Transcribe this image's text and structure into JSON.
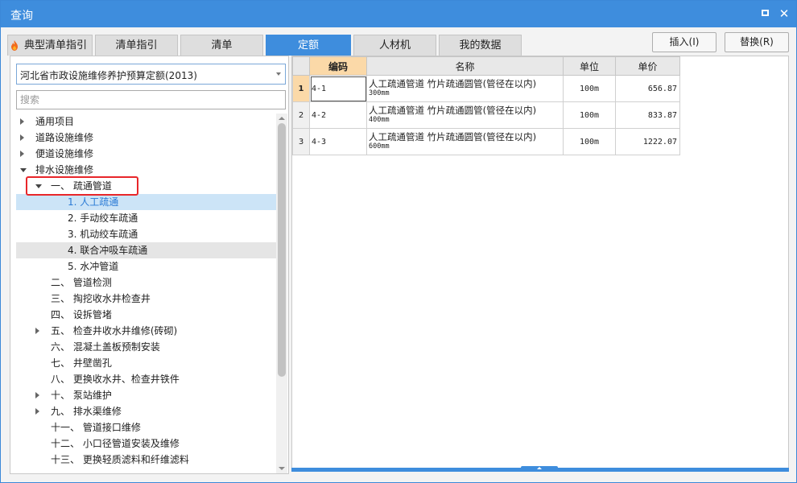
{
  "window": {
    "title": "查询"
  },
  "tabs": [
    {
      "label": "典型清单指引",
      "active": false
    },
    {
      "label": "清单指引",
      "active": false
    },
    {
      "label": "清单",
      "active": false
    },
    {
      "label": "定额",
      "active": true
    },
    {
      "label": "人材机",
      "active": false
    },
    {
      "label": "我的数据",
      "active": false
    }
  ],
  "actions": {
    "insert": "插入(I)",
    "replace": "替换(R)"
  },
  "left": {
    "selected_library": "河北省市政设施维修养护预算定额(2013)",
    "search_placeholder": "搜索",
    "tree": [
      {
        "label": "通用项目",
        "expander": "collapsed"
      },
      {
        "label": "道路设施维修",
        "expander": "collapsed"
      },
      {
        "label": "便道设施维修",
        "expander": "collapsed"
      },
      {
        "label": "排水设施维修",
        "expander": "expanded"
      },
      {
        "label": "一、 疏通管道",
        "expander": "expanded"
      },
      {
        "label": "1. 人工疏通",
        "expander": "none",
        "state": "selected"
      },
      {
        "label": "2. 手动绞车疏通",
        "expander": "none"
      },
      {
        "label": "3. 机动绞车疏通",
        "expander": "none"
      },
      {
        "label": "4. 联合冲吸车疏通",
        "expander": "none",
        "state": "hover"
      },
      {
        "label": "5. 水冲管道",
        "expander": "none"
      },
      {
        "label": "二、 管道检测",
        "expander": "none"
      },
      {
        "label": "三、 掏挖收水井检查井",
        "expander": "none"
      },
      {
        "label": "四、 设拆管堵",
        "expander": "none"
      },
      {
        "label": "五、 检查井收水井维修(砖砌)",
        "expander": "collapsed"
      },
      {
        "label": "六、 混凝土盖板预制安装",
        "expander": "none"
      },
      {
        "label": "七、 井壁凿孔",
        "expander": "none"
      },
      {
        "label": "八、 更换收水井、检查井铁件",
        "expander": "none"
      },
      {
        "label": "十、 泵站维护",
        "expander": "collapsed"
      },
      {
        "label": "九、 排水渠维修",
        "expander": "collapsed"
      },
      {
        "label": "十一、 管道接口维修",
        "expander": "none"
      },
      {
        "label": "十二、 小口径管道安装及维修",
        "expander": "none"
      },
      {
        "label": "十三、 更换轻质滤料和纤维滤料",
        "expander": "none"
      }
    ]
  },
  "grid": {
    "columns": [
      "编码",
      "名称",
      "单位",
      "单价"
    ],
    "rows": [
      {
        "num": "1",
        "code": "4-1",
        "name": "人工疏通管道 竹片疏通圆管(管径在以内)",
        "spec": "300mm",
        "unit": "100m",
        "price": "656.87"
      },
      {
        "num": "2",
        "code": "4-2",
        "name": "人工疏通管道 竹片疏通圆管(管径在以内)",
        "spec": "400mm",
        "unit": "100m",
        "price": "833.87"
      },
      {
        "num": "3",
        "code": "4-3",
        "name": "人工疏通管道 竹片疏通圆管(管径在以内)",
        "spec": "600mm",
        "unit": "100m",
        "price": "1222.07"
      }
    ]
  },
  "colors": {
    "accent": "#3e8ddd",
    "selection": "#cce4f7",
    "header_highlight": "#fbd9a8",
    "annotation": "#e8262a"
  }
}
